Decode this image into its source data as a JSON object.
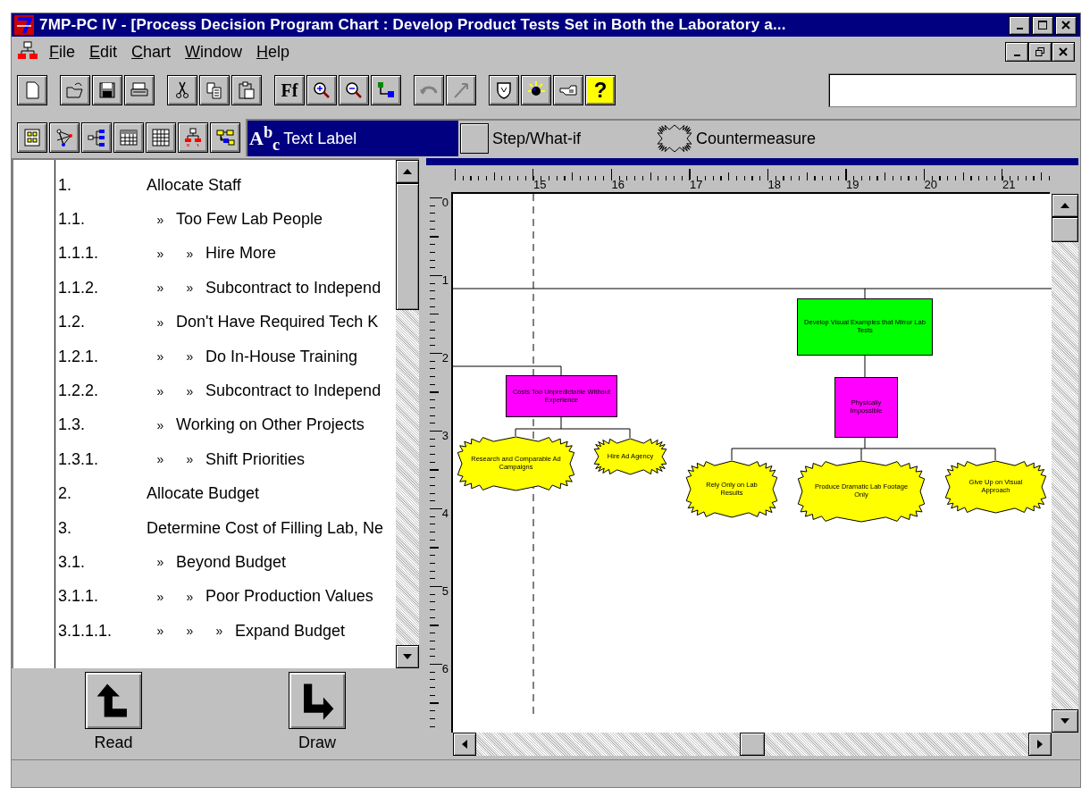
{
  "window": {
    "title": "7MP-PC IV - [Process Decision Program Chart : Develop Product Tests Set in Both the Laboratory a..."
  },
  "menu": [
    "File",
    "Edit",
    "Chart",
    "Window",
    "Help"
  ],
  "toolbar": {
    "font_label": "Ff",
    "help_label": "?",
    "undo_disabled": true,
    "redo_disabled": true
  },
  "palette": [
    {
      "kind": "text",
      "label": "Text Label",
      "glyph": "A$^{b}$$_{c}$",
      "selected": true
    },
    {
      "kind": "step",
      "label": "Step/What-if",
      "selected": false
    },
    {
      "kind": "countermeasure",
      "label": "Countermeasure",
      "selected": false
    }
  ],
  "outline": {
    "depth_marker": "»",
    "items": [
      {
        "number": "1.",
        "label": "Allocate Staff",
        "children": [
          {
            "number": "1.1.",
            "label": "Too Few Lab People",
            "children": [
              {
                "number": "1.1.1.",
                "label": "Hire More"
              },
              {
                "number": "1.1.2.",
                "label": "Subcontract to Independ"
              }
            ]
          },
          {
            "number": "1.2.",
            "label": "Don't Have Required Tech K",
            "children": [
              {
                "number": "1.2.1.",
                "label": "Do In-House Training"
              },
              {
                "number": "1.2.2.",
                "label": "Subcontract to Independ"
              }
            ]
          },
          {
            "number": "1.3.",
            "label": "Working on Other Projects",
            "children": [
              {
                "number": "1.3.1.",
                "label": "Shift Priorities"
              }
            ]
          }
        ]
      },
      {
        "number": "2.",
        "label": "Allocate Budget"
      },
      {
        "number": "3.",
        "label": "Determine Cost of Filling Lab, Ne",
        "children": [
          {
            "number": "3.1.",
            "label": "Beyond Budget",
            "children": [
              {
                "number": "3.1.1.",
                "label": "Poor Production Values",
                "children": [
                  {
                    "number": "3.1.1.1.",
                    "label": "Expand Budget"
                  }
                ]
              }
            ]
          }
        ]
      }
    ]
  },
  "bottom_buttons": [
    "Read",
    "Draw"
  ],
  "ruler": {
    "horizontal": [
      "15",
      "16",
      "17",
      "18",
      "19",
      "20",
      "21"
    ],
    "vertical": [
      "0",
      "1",
      "2",
      "3",
      "4",
      "5",
      "6"
    ]
  },
  "chart_nodes": [
    {
      "kind": "step",
      "color": "#ff00ff",
      "text": "Costs Too Unpredictable Without Experience"
    },
    {
      "kind": "countermeasure",
      "color": "#ffff00",
      "text": "Research and Comparable Ad Campaigns"
    },
    {
      "kind": "countermeasure",
      "color": "#ffff00",
      "text": "Hire Ad Agency"
    },
    {
      "kind": "step",
      "color": "#00ff00",
      "text": "Develop Visual Examples that Mirror Lab Tests"
    },
    {
      "kind": "step",
      "color": "#ff00ff",
      "text": "Physically Impossible"
    },
    {
      "kind": "countermeasure",
      "color": "#ffff00",
      "text": "Rely Only on Lab Results"
    },
    {
      "kind": "countermeasure",
      "color": "#ffff00",
      "text": "Produce Dramatic Lab Footage Only"
    },
    {
      "kind": "countermeasure",
      "color": "#ffff00",
      "text": "Give Up on Visual Approach"
    }
  ]
}
